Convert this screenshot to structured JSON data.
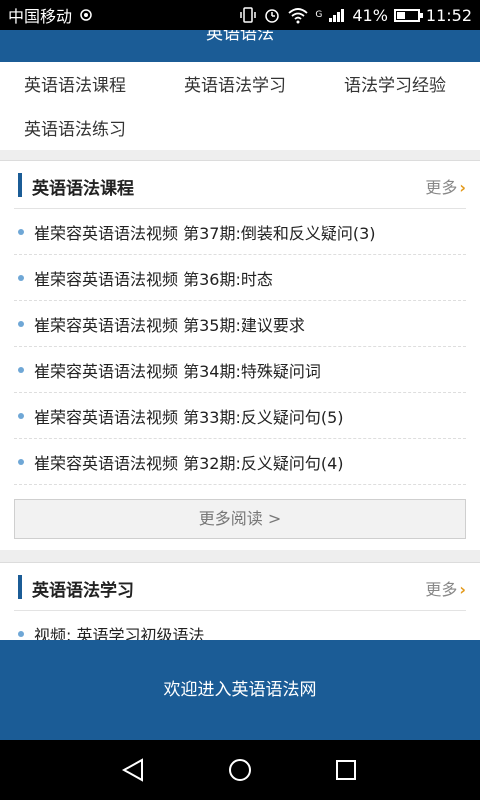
{
  "status_bar": {
    "carrier": "中国移动",
    "network": "G",
    "battery_percent_label": "41%",
    "battery_level": 0.41,
    "time": "11:52"
  },
  "header": {
    "title": "英语语法"
  },
  "nav": {
    "items": [
      {
        "label": "英语语法课程"
      },
      {
        "label": "英语语法学习"
      },
      {
        "label": "语法学习经验"
      },
      {
        "label": "英语语法练习"
      }
    ]
  },
  "section1": {
    "title": "英语语法课程",
    "more": "更多",
    "items": [
      {
        "text": "崔荣容英语语法视频 第37期:倒装和反义疑问(3)"
      },
      {
        "text": "崔荣容英语语法视频 第36期:时态"
      },
      {
        "text": "崔荣容英语语法视频 第35期:建议要求"
      },
      {
        "text": "崔荣容英语语法视频 第34期:特殊疑问词"
      },
      {
        "text": "崔荣容英语语法视频 第33期:反义疑问句(5)"
      },
      {
        "text": "崔荣容英语语法视频 第32期:反义疑问句(4)"
      }
    ],
    "read_more": "更多阅读 >"
  },
  "section2": {
    "title": "英语语法学习",
    "more": "更多",
    "items": [
      {
        "text": "视频: 英语学习初级语法"
      }
    ]
  },
  "banner": {
    "text": "欢迎进入英语语法网"
  },
  "colors": {
    "primary": "#1b5c96",
    "accent": "#e39a1c",
    "bullet": "#6fa7d6"
  }
}
